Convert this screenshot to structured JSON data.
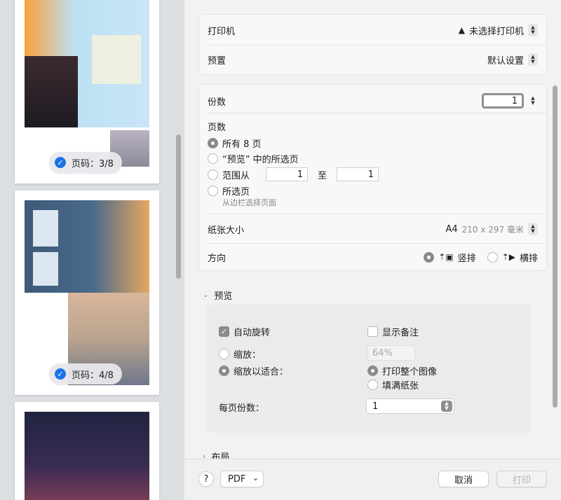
{
  "sidebar": {
    "badges": [
      {
        "label": "页码：3/8"
      },
      {
        "label": "页码：4/8"
      }
    ]
  },
  "printer_group": {
    "printer_label": "打印机",
    "printer_value": "未选择打印机",
    "preset_label": "预置",
    "preset_value": "默认设置"
  },
  "settings": {
    "copies_label": "份数",
    "copies_value": "1",
    "pages_label": "页数",
    "page_options": {
      "all": "所有 8 页",
      "selected_in_preview": "“预览” 中的所选页",
      "range_from": "范围从",
      "range_to": "至",
      "range_from_value": "1",
      "range_to_value": "1",
      "selected": "所选页",
      "selected_hint": "从边栏选择页面"
    },
    "paper_label": "纸张大小",
    "paper_value": "A4",
    "paper_dims": "210 x 297 毫米",
    "orientation_label": "方向",
    "portrait_label": "竖排",
    "landscape_label": "横排"
  },
  "preview": {
    "section_label": "预览",
    "auto_rotate": "自动旋转",
    "show_notes": "显示备注",
    "scale_label": "缩放：",
    "scale_value": "64%",
    "scale_fit_label": "缩放以适合：",
    "print_entire": "打印整个图像",
    "fill_paper": "填满纸张",
    "per_page_label": "每页份数：",
    "per_page_value": "1"
  },
  "layout_section": "布局",
  "footer": {
    "help": "?",
    "pdf": "PDF",
    "cancel": "取消",
    "print": "打印"
  },
  "colors": {
    "accent": "#1a73e8",
    "sidebar_bg": "#dcdfe2"
  }
}
